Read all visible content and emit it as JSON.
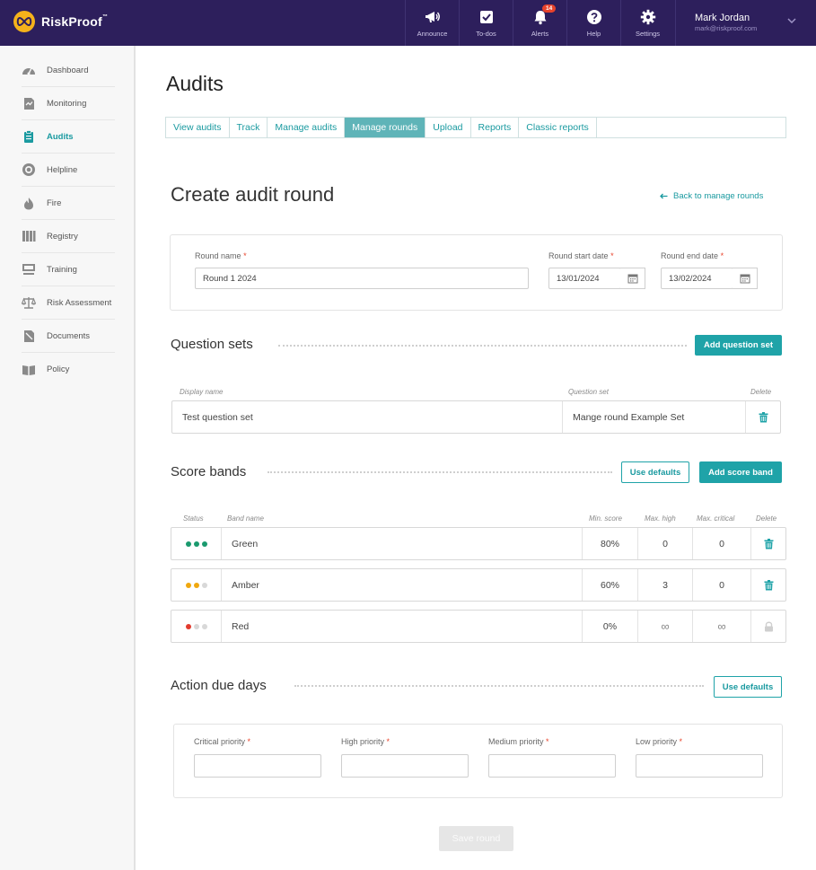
{
  "app": {
    "brand": "RiskProof",
    "brand_mark": "™"
  },
  "topnav": {
    "items": [
      {
        "label": "Announce",
        "icon": "megaphone-icon"
      },
      {
        "label": "To-dos",
        "icon": "checkbox-icon"
      },
      {
        "label": "Alerts",
        "icon": "bell-icon",
        "badge": "14"
      },
      {
        "label": "Help",
        "icon": "help-icon"
      },
      {
        "label": "Settings",
        "icon": "gear-icon"
      }
    ],
    "user": {
      "name": "Mark Jordan",
      "email": "mark@riskproof.com"
    }
  },
  "sidebar": {
    "items": [
      {
        "label": "Dashboard",
        "icon": "dashboard-gauge-icon"
      },
      {
        "label": "Monitoring",
        "icon": "monitoring-icon"
      },
      {
        "label": "Audits",
        "icon": "clipboard-icon",
        "active": true
      },
      {
        "label": "Helpline",
        "icon": "helpline-icon"
      },
      {
        "label": "Fire",
        "icon": "flame-icon"
      },
      {
        "label": "Registry",
        "icon": "registry-icon"
      },
      {
        "label": "Training",
        "icon": "training-icon"
      },
      {
        "label": "Risk Assessment",
        "icon": "scales-icon"
      },
      {
        "label": "Documents",
        "icon": "documents-icon"
      },
      {
        "label": "Policy",
        "icon": "book-icon"
      }
    ]
  },
  "page": {
    "title": "Audits",
    "tabs": [
      {
        "label": "View audits"
      },
      {
        "label": "Track"
      },
      {
        "label": "Manage audits"
      },
      {
        "label": "Manage rounds",
        "active": true
      },
      {
        "label": "Upload"
      },
      {
        "label": "Reports"
      },
      {
        "label": "Classic reports"
      }
    ],
    "heading": "Create audit round",
    "back_link": "Back to manage rounds"
  },
  "round": {
    "name_label": "Round name",
    "name_value": "Round 1 2024",
    "start_label": "Round start date",
    "start_value": "13/01/2024",
    "end_label": "Round end date",
    "end_value": "13/02/2024",
    "required_mark": "*"
  },
  "question_sets": {
    "title": "Question sets",
    "add_button": "Add question set",
    "columns": {
      "display_name": "Display name",
      "question_set": "Question set",
      "delete": "Delete"
    },
    "rows": [
      {
        "display_name": "Test question set",
        "question_set": "Mange round Example Set"
      }
    ]
  },
  "score_bands": {
    "title": "Score bands",
    "defaults_button": "Use defaults",
    "add_button": "Add score band",
    "columns": {
      "status": "Status",
      "band_name": "Band name",
      "min_score": "Min. score",
      "max_high": "Max. high",
      "max_critical": "Max. critical",
      "delete": "Delete"
    },
    "rows": [
      {
        "name": "Green",
        "min_score": "80%",
        "max_high": "0",
        "max_critical": "0",
        "status_dots": [
          "#1a9a6e",
          "#1a9a6e",
          "#1a9a6e"
        ],
        "locked": false
      },
      {
        "name": "Amber",
        "min_score": "60%",
        "max_high": "3",
        "max_critical": "0",
        "status_dots": [
          "#f0a80f",
          "#f0a80f",
          "#d8d8d8"
        ],
        "locked": false
      },
      {
        "name": "Red",
        "min_score": "0%",
        "max_high": "∞",
        "max_critical": "∞",
        "status_dots": [
          "#e23b2e",
          "#d8d8d8",
          "#d8d8d8"
        ],
        "locked": true
      }
    ]
  },
  "action_due": {
    "title": "Action due days",
    "defaults_button": "Use defaults",
    "fields": [
      {
        "label": "Critical priority",
        "value": ""
      },
      {
        "label": "High priority",
        "value": ""
      },
      {
        "label": "Medium priority",
        "value": ""
      },
      {
        "label": "Low priority",
        "value": ""
      }
    ]
  },
  "save_button": "Save round",
  "colors": {
    "accent": "#1fa3a8",
    "topbar": "#2d1f5c",
    "required": "#e8432b"
  }
}
